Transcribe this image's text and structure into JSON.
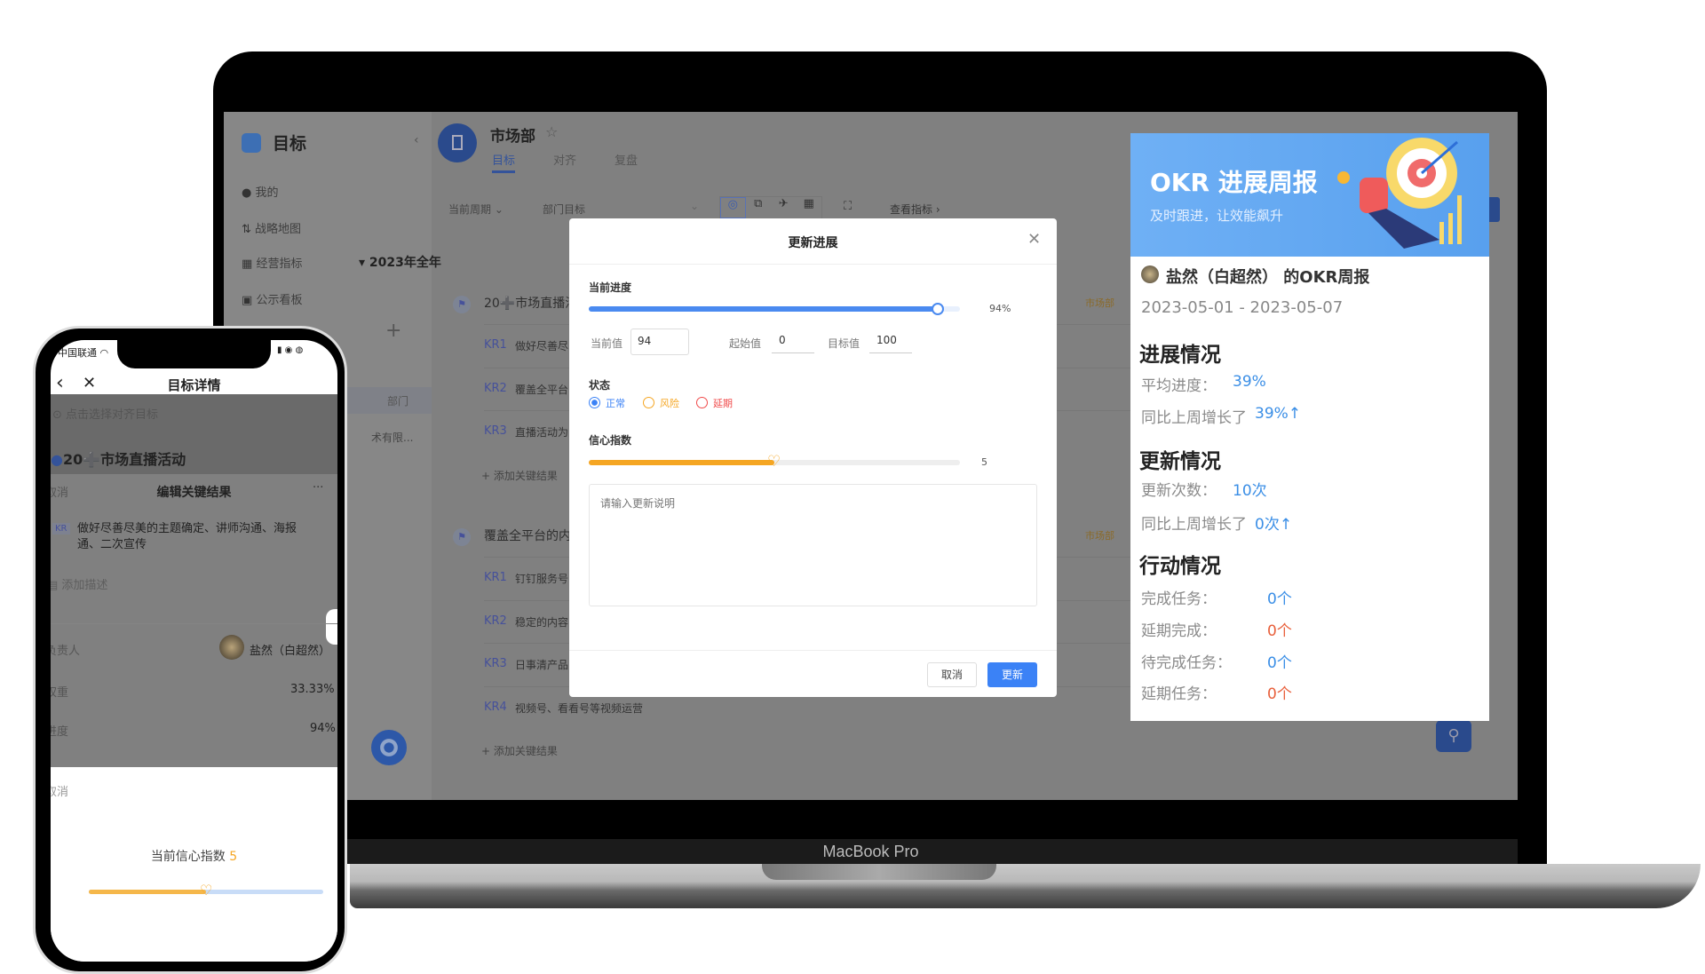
{
  "device": {
    "laptop_label": "MacBook Pro"
  },
  "sidebar": {
    "title": "目标",
    "items": [
      {
        "label": "我的",
        "icon": "user-icon"
      },
      {
        "label": "战略地图",
        "icon": "strategy-map-icon"
      },
      {
        "label": "经营指标",
        "icon": "metrics-icon"
      },
      {
        "label": "公示看板",
        "icon": "board-icon"
      }
    ],
    "add_label": "+",
    "dept_item": "部门",
    "company_item": "术有限..."
  },
  "header": {
    "dept_name": "市场部",
    "tabs": [
      {
        "label": "目标",
        "active": true
      },
      {
        "label": "对齐"
      },
      {
        "label": "复盘"
      }
    ]
  },
  "toolbar": {
    "period": "当前周期",
    "scope": "部门目标",
    "view_metrics": "查看指标",
    "icons": [
      "target-icon",
      "image-icon",
      "run-icon",
      "table-icon",
      "expand-icon"
    ]
  },
  "goals": {
    "year": "2023年全年",
    "objectives": [
      {
        "title": "20➕市场直播活",
        "tag": "市场部",
        "krs": [
          {
            "label": "KR1",
            "text": "做好尽善尽"
          },
          {
            "label": "KR2",
            "text": "覆盖全平台"
          },
          {
            "label": "KR3",
            "text": "直播活动为"
          }
        ]
      },
      {
        "title": "覆盖全平台的内",
        "tag": "市场部",
        "krs": [
          {
            "label": "KR1",
            "text": "钉钉服务号"
          },
          {
            "label": "KR2",
            "text": "稳定的内容"
          },
          {
            "label": "KR3",
            "text": "日事清产品"
          },
          {
            "label": "KR4",
            "text": "视频号、看看号等视频运营"
          }
        ]
      }
    ],
    "add_kr": "+ 添加关键结果"
  },
  "dialog": {
    "title": "更新进展",
    "progress_label": "当前进度",
    "progress_value": 94,
    "progress_text": "94%",
    "current_label": "当前值",
    "current_value": "94",
    "start_label": "起始值",
    "start_value": "0",
    "target_label": "目标值",
    "target_value": "100",
    "status_label": "状态",
    "status_options": [
      {
        "label": "正常",
        "color": "#3b82f6",
        "checked": true
      },
      {
        "label": "风险",
        "color": "#f5a623"
      },
      {
        "label": "延期",
        "color": "#f04a4a"
      }
    ],
    "confidence_label": "信心指数",
    "confidence_value": 5,
    "confidence_max": 10,
    "confidence_text": "5",
    "note_placeholder": "请输入更新说明",
    "cancel": "取消",
    "submit": "更新",
    "accent": "#3b82f6",
    "confidence_color": "#f5a623"
  },
  "report": {
    "banner_title": "OKR 进展周报",
    "banner_subtitle": "及时跟进，让效能飙升",
    "user_title": "盐然（白超然） 的OKR周报",
    "date_range": "2023-05-01 - 2023-05-07",
    "sections": [
      {
        "heading": "进展情况",
        "rows": [
          {
            "label": "平均进度：",
            "value": "39%",
            "color": "#3a8ee6"
          },
          {
            "label": "同比上周增长了",
            "value": "39%↑",
            "color": "#3a8ee6"
          }
        ]
      },
      {
        "heading": "更新情况",
        "rows": [
          {
            "label": "更新次数：",
            "value": "10次",
            "color": "#3a8ee6"
          },
          {
            "label": "同比上周增长了",
            "value": "0次↑",
            "color": "#3a8ee6"
          }
        ]
      },
      {
        "heading": "行动情况",
        "rows": [
          {
            "label": "完成任务：",
            "value": "0个",
            "color": "#3a8ee6"
          },
          {
            "label": "延期完成：",
            "value": "0个",
            "color": "#e8603c"
          },
          {
            "label": "待完成任务：",
            "value": "0个",
            "color": "#3a8ee6"
          },
          {
            "label": "延期任务：",
            "value": "0个",
            "color": "#e8603c"
          }
        ]
      }
    ]
  },
  "phone": {
    "carrier": "中国联通",
    "nav_title": "目标详情",
    "align_hint": "点击选择对齐目标",
    "objective": "20➕市场直播活动",
    "sheet_cancel": "取消",
    "sheet_title": "编辑关键结果",
    "sheet_more": "···",
    "kr_badge": "KR",
    "kr_text": "做好尽善尽美的主题确定、讲师沟通、海报",
    "kr_text2": "通、二次宣传",
    "add_desc": "添加描述",
    "owner_label": "负责人",
    "owner_name": "盐然（白超然）",
    "weight_label": "权重",
    "weight_value": "33.33%",
    "progress_label": "进度",
    "progress_value": "94%",
    "bottom_cancel": "取消",
    "confidence_label": "当前信心指数",
    "confidence_value": "5",
    "confidence_fraction": 0.5
  }
}
